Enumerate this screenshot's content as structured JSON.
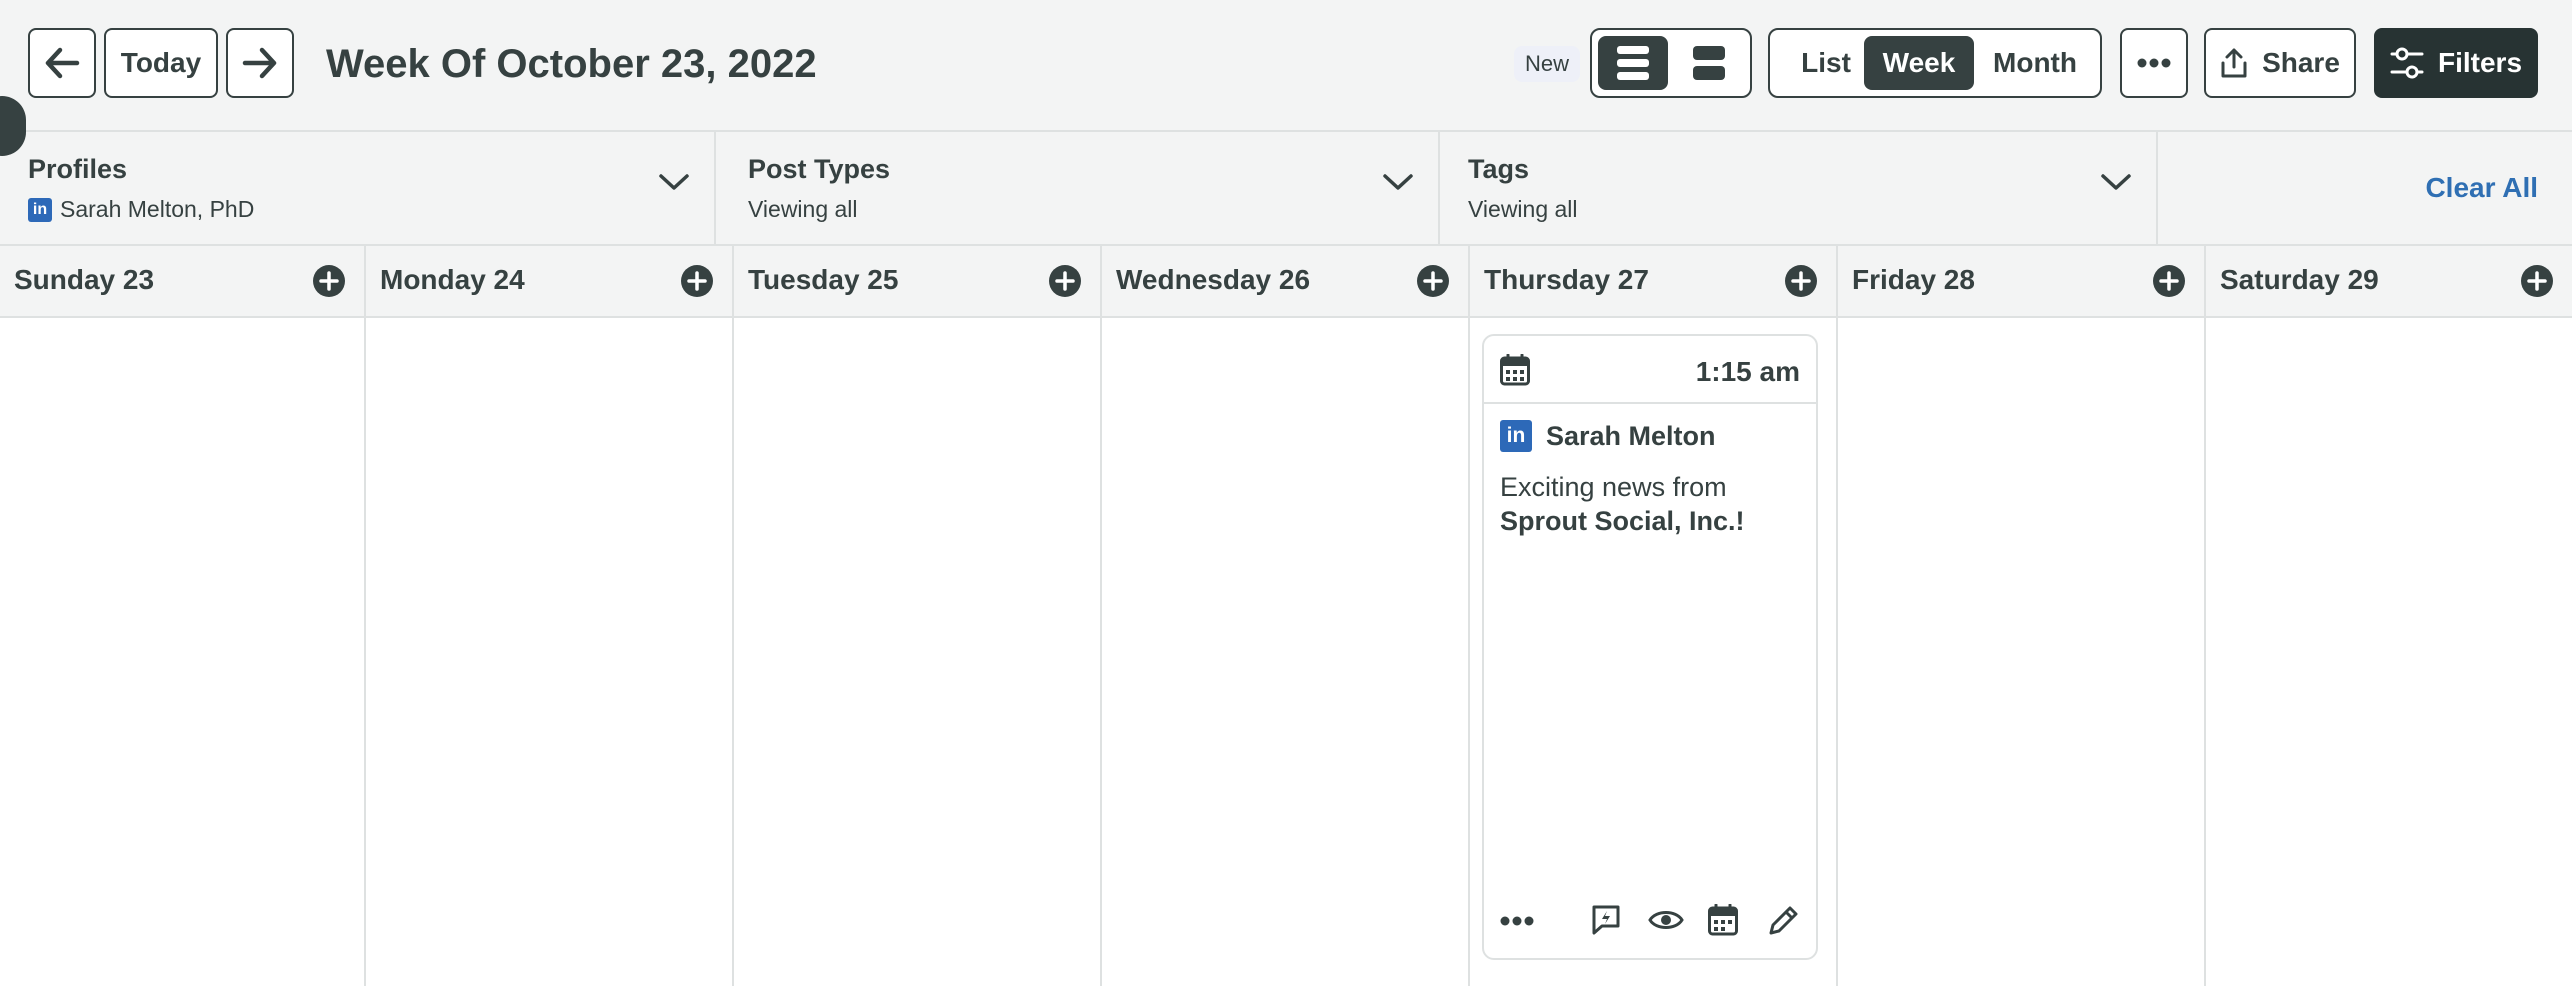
{
  "toolbar": {
    "today_label": "Today",
    "title": "Week Of October 23, 2022",
    "new_badge": "New",
    "views": [
      "List",
      "Week",
      "Month"
    ],
    "active_view": "Week",
    "share_label": "Share",
    "filters_label": "Filters"
  },
  "filters": {
    "profiles": {
      "title": "Profiles",
      "value": "Sarah Melton, PhD",
      "network_icon": "linkedin-icon"
    },
    "post_types": {
      "title": "Post Types",
      "value": "Viewing all"
    },
    "tags": {
      "title": "Tags",
      "value": "Viewing all"
    },
    "clear_all": "Clear All"
  },
  "days": [
    {
      "label": "Sunday 23"
    },
    {
      "label": "Monday 24"
    },
    {
      "label": "Tuesday 25"
    },
    {
      "label": "Wednesday 26"
    },
    {
      "label": "Thursday 27"
    },
    {
      "label": "Friday 28"
    },
    {
      "label": "Saturday 29"
    }
  ],
  "post": {
    "time": "1:15 am",
    "author": "Sarah Melton",
    "network_icon": "linkedin-icon",
    "text_prefix": "Exciting news from",
    "text_bold": "Sprout Social, Inc.!"
  },
  "colors": {
    "text": "#364141",
    "dark": "#273333",
    "link": "#2f6fb3",
    "linkedin": "#2d69b8",
    "toolbar_bg": "#f3f4f4",
    "border": "#dee1e1"
  }
}
